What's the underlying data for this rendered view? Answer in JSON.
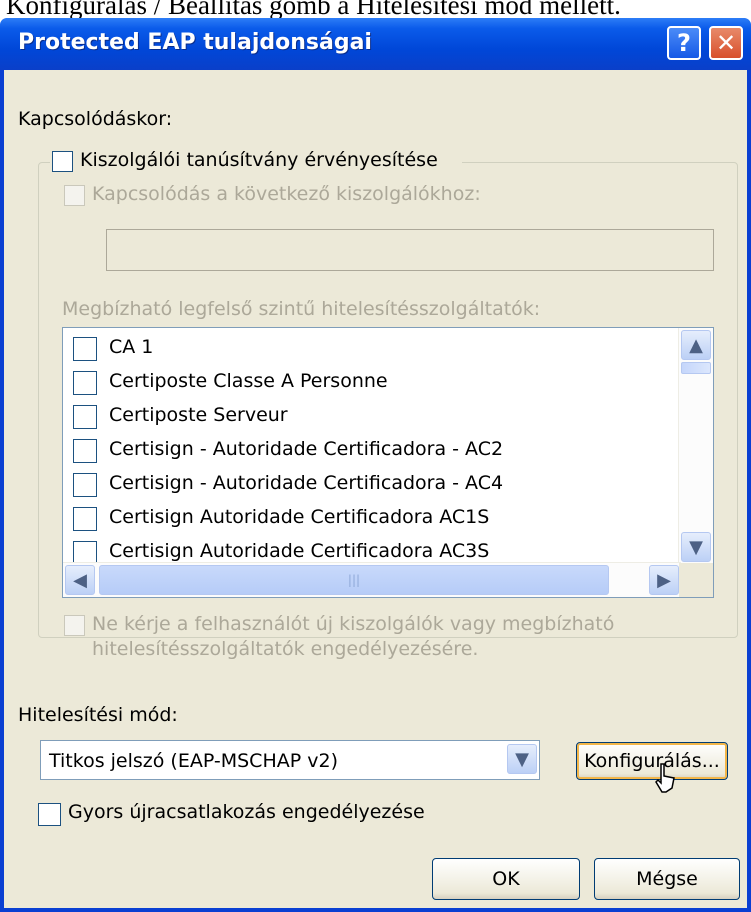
{
  "caption_text": "Konfigurálás / Beállítás gomb a Hitelesítési mód mellett.",
  "window": {
    "title": "Protected EAP tulajdonságai",
    "help_button": "?",
    "close_button": "✕"
  },
  "connect_label": "Kapcsolódáskor:",
  "validate_cert": {
    "label": "Kiszolgálói tanúsítvány érvényesítése",
    "checked": false
  },
  "connect_servers": {
    "label": "Kapcsolódás a következő kiszolgálókhoz:",
    "value": "",
    "enabled": false
  },
  "trusted_ca": {
    "label": "Megbízható legfelső szintű hitelesítésszolgáltatók:",
    "items": [
      "CA 1",
      "Certiposte Classe A Personne",
      "Certiposte Serveur",
      "Certisign - Autoridade Certificadora - AC2",
      "Certisign - Autoridade Certificadora - AC4",
      "Certisign Autoridade Certificadora AC1S",
      "Certisign Autoridade Certificadora AC3S"
    ],
    "scroll": {
      "up": "▲",
      "down": "▼",
      "left": "◀",
      "right": "▶",
      "grip": "|||"
    }
  },
  "no_prompt": {
    "line1": "Ne kérje a felhasználót új kiszolgálók vagy megbízható",
    "line2": "hitelesítésszolgáltatók engedélyezésére."
  },
  "auth_method": {
    "label": "Hitelesítési mód:",
    "value": "Titkos jelszó (EAP-MSCHAP v2)",
    "configure_button": "Konfigurálás..."
  },
  "fast_reconnect": {
    "label": "Gyors újracsatlakozás engedélyezése",
    "checked": false
  },
  "buttons": {
    "ok": "OK",
    "cancel": "Mégse"
  },
  "colors": {
    "titlebar": "#0047d8",
    "face": "#ece9d8",
    "disabled_text": "#aca899"
  }
}
